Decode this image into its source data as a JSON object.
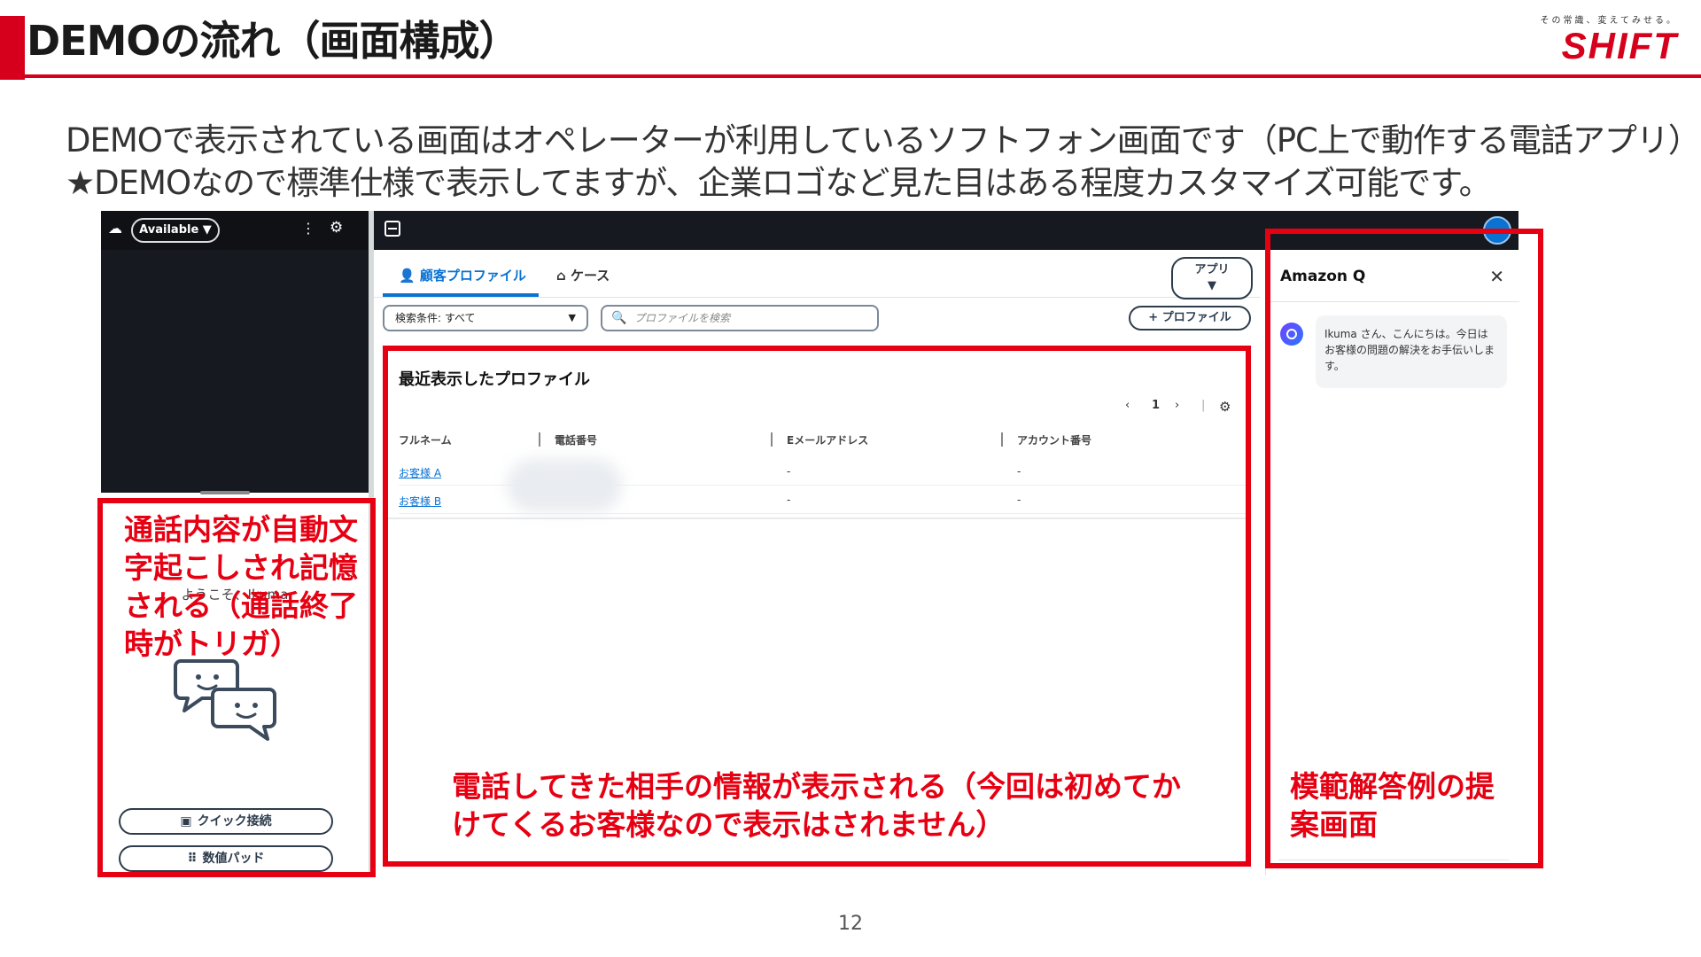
{
  "slide": {
    "title": "DEMOの流れ（画面構成）",
    "brand_tagline": "その常識、変えてみせる。",
    "brand_logo": "SHIFT",
    "description_line1": "DEMOで表示されている画面はオペレーターが利用しているソフトフォン画面です（PC上で動作する電話アプリ）",
    "description_line2": "★DEMOなので標準仕様で表示してますが、企業ロゴなど見た目はある程度カスタマイズ可能です。",
    "page_number": "12",
    "accent_color": "#d6001c"
  },
  "ccp": {
    "status": "Available ▼",
    "greeting": "ようこそ、Ikuma",
    "quick_connect_label": "クイック接続",
    "number_pad_label": "数値パッド"
  },
  "workspace": {
    "tabs": [
      {
        "label": "顧客プロファイル",
        "icon": "user-icon"
      },
      {
        "label": "ケース",
        "icon": "briefcase-icon"
      }
    ],
    "apps_label": "アプリ",
    "apps_caret": "▼",
    "search_filter": "検索条件: すべて",
    "search_placeholder": "プロファイルを検索",
    "add_profile_label": "プロファイル",
    "recent_title": "最近表示したプロファイル",
    "page_current": "1",
    "columns": [
      "フルネーム",
      "電話番号",
      "Eメールアドレス",
      "アカウント番号"
    ],
    "rows": [
      {
        "name": "お客様 A",
        "email": "-",
        "account": "-"
      },
      {
        "name": "お客様 B",
        "email": "-",
        "account": "-"
      }
    ]
  },
  "amazon_q": {
    "title": "Amazon Q",
    "message": "Ikuma さん、こんにちは。今日はお客様の問題の解決をお手伝いします。"
  },
  "annotations": {
    "left": "通話内容が自動文字起こしされ記憶される（通話終了時がトリガ）",
    "center": [
      "電話してきた相手の情報が表示される（今回は初めてか",
      "けてくるお客様なので表示はされません）"
    ],
    "right": [
      "模範解答例の提",
      "案画面"
    ],
    "color": "#e60012"
  }
}
